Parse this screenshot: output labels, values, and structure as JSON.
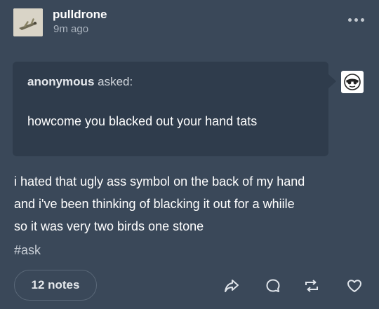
{
  "post": {
    "username": "pulldrone",
    "timestamp": "9m ago",
    "ask": {
      "asker": "anonymous",
      "asked_suffix": "asked:",
      "question": "howcome you blacked out your hand tats"
    },
    "answer_lines": [
      "i hated that ugly ass symbol on the back of my hand",
      "and i've been thinking of blacking it out for a whiile",
      "so it was very two birds one stone"
    ],
    "tag": "#ask",
    "notes": "12 notes",
    "actions": [
      "share-icon",
      "reply-icon",
      "reblog-icon",
      "like-icon"
    ],
    "colors": {
      "background": "#3a4859",
      "ask_bubble": "#2f3c4c",
      "text": "#ffffff",
      "muted": "#aab3be"
    }
  }
}
